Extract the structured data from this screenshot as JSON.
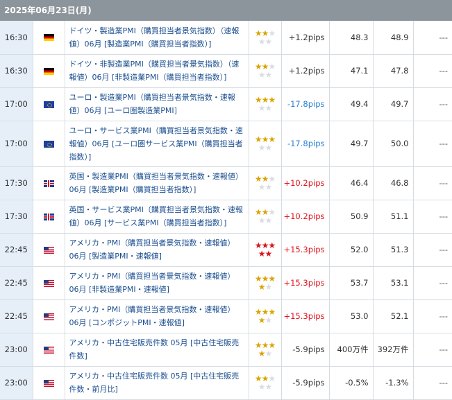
{
  "date_header": "2025年06月23日(月)",
  "colors": {
    "header_bg": "#8d959c",
    "time_bg": "#e6eff8",
    "link": "#1a4e8f",
    "positive_pips": "#e1141d",
    "negative_pips": "#2a7fd0",
    "star_gold": "#d9a400",
    "star_red": "#d8141d"
  },
  "rows": [
    {
      "time": "16:30",
      "flag_icon": "germany-flag-icon",
      "event": "ドイツ・製造業PMI（購買担当者景気指数）（速報値）06月 [製造業PMI（購買担当者指数）]",
      "stars": "★★",
      "stars_off": "★",
      "stars2": "",
      "stars2_off": "★★",
      "pips": "+1.2pips",
      "pips_class": "zero",
      "prev": "48.3",
      "forecast": "48.9",
      "actual": "---"
    },
    {
      "time": "16:30",
      "flag_icon": "germany-flag-icon",
      "event": "ドイツ・非製造業PMI（購買担当者景気指数）（速報値）06月 [非製造業PMI（購買担当者指数）]",
      "stars": "★★",
      "stars_off": "★",
      "stars2": "",
      "stars2_off": "★★",
      "pips": "+1.2pips",
      "pips_class": "zero",
      "prev": "47.1",
      "forecast": "47.8",
      "actual": "---"
    },
    {
      "time": "17:00",
      "flag_icon": "eu-flag-icon",
      "event": "ユーロ・製造業PMI（購買担当者景気指数・速報値）06月 [ユーロ圏製造業PMI]",
      "stars": "★★★",
      "stars_off": "",
      "stars2": "",
      "stars2_off": "★★",
      "pips": "-17.8pips",
      "pips_class": "neg",
      "prev": "49.4",
      "forecast": "49.7",
      "actual": "---"
    },
    {
      "time": "17:00",
      "flag_icon": "eu-flag-icon",
      "event": "ユーロ・サービス業PMI（購買担当者景気指数・速報値）06月 [ユーロ圏サービス業PMI（購買担当者指数）]",
      "stars": "★★★",
      "stars_off": "",
      "stars2": "",
      "stars2_off": "★★",
      "pips": "-17.8pips",
      "pips_class": "neg",
      "prev": "49.7",
      "forecast": "50.0",
      "actual": "---"
    },
    {
      "time": "17:30",
      "flag_icon": "uk-flag-icon",
      "event": "英国・製造業PMI（購買担当者景気指数・速報値）06月 [製造業PMI（購買担当者指数）]",
      "stars": "★★",
      "stars_off": "★",
      "stars2": "",
      "stars2_off": "★★",
      "pips": "+10.2pips",
      "pips_class": "pos",
      "prev": "46.4",
      "forecast": "46.8",
      "actual": "---"
    },
    {
      "time": "17:30",
      "flag_icon": "uk-flag-icon",
      "event": "英国・サービス業PMI（購買担当者景気指数・速報値）06月 [サービス業PMI（購買担当者指数）]",
      "stars": "★★",
      "stars_off": "★",
      "stars2": "",
      "stars2_off": "★★",
      "pips": "+10.2pips",
      "pips_class": "pos",
      "prev": "50.9",
      "forecast": "51.1",
      "actual": "---"
    },
    {
      "time": "22:45",
      "flag_icon": "us-flag-icon",
      "event": "アメリカ・PMI（購買担当者景気指数・速報値）06月 [製造業PMI・速報値]",
      "stars": "★★★",
      "stars_off": "",
      "stars2": "★★",
      "stars2_off": "",
      "hi": true,
      "pips": "+15.3pips",
      "pips_class": "pos",
      "prev": "52.0",
      "forecast": "51.3",
      "actual": "---"
    },
    {
      "time": "22:45",
      "flag_icon": "us-flag-icon",
      "event": "アメリカ・PMI（購買担当者景気指数・速報値）06月 [非製造業PMI・速報値]",
      "stars": "★★★",
      "stars_off": "",
      "stars2": "★",
      "stars2_off": "★",
      "pips": "+15.3pips",
      "pips_class": "pos",
      "prev": "53.7",
      "forecast": "53.1",
      "actual": "---"
    },
    {
      "time": "22:45",
      "flag_icon": "us-flag-icon",
      "event": "アメリカ・PMI（購買担当者景気指数・速報値）06月 [コンポジットPMI・速報値]",
      "stars": "★★★",
      "stars_off": "",
      "stars2": "★",
      "stars2_off": "★",
      "pips": "+15.3pips",
      "pips_class": "pos",
      "prev": "53.0",
      "forecast": "52.1",
      "actual": "---"
    },
    {
      "time": "23:00",
      "flag_icon": "us-flag-icon",
      "event": "アメリカ・中古住宅販売件数 05月 [中古住宅販売件数]",
      "stars": "★★★",
      "stars_off": "",
      "stars2": "★",
      "stars2_off": "★",
      "pips": "-5.9pips",
      "pips_class": "zero",
      "prev": "400万件",
      "forecast": "392万件",
      "actual": "---"
    },
    {
      "time": "23:00",
      "flag_icon": "us-flag-icon",
      "event": "アメリカ・中古住宅販売件数 05月 [中古住宅販売件数・前月比]",
      "stars": "★★",
      "stars_off": "★",
      "stars2": "",
      "stars2_off": "★★",
      "pips": "-5.9pips",
      "pips_class": "zero",
      "prev": "-0.5%",
      "forecast": "-1.3%",
      "actual": "---"
    }
  ]
}
